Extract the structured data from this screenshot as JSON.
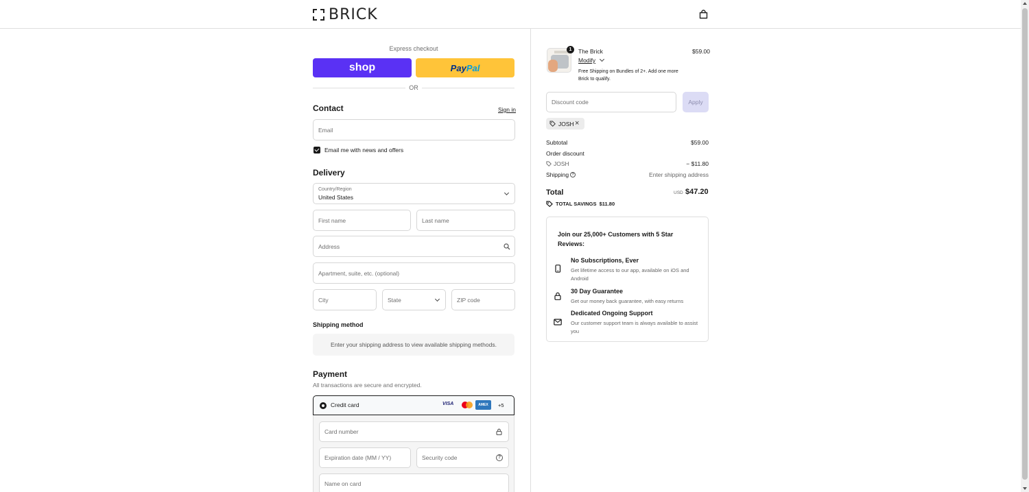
{
  "header": {
    "brand": "BRICK",
    "brand_icon": "brick-logo-icon",
    "cart_icon": "shopping-bag-icon"
  },
  "express": {
    "label": "Express checkout",
    "shop_label": "shop",
    "paypal_part1": "Pay",
    "paypal_part2": "Pal",
    "or": "OR",
    "shop_color": "#5a31f4",
    "paypal_color": "#ffc439"
  },
  "contact": {
    "title": "Contact",
    "signin": "Sign in",
    "email_placeholder": "Email",
    "newsletter_label": "Email me with news and offers",
    "newsletter_checked": true
  },
  "delivery": {
    "title": "Delivery",
    "country_label": "Country/Region",
    "country_value": "United States",
    "first_name_placeholder": "First name",
    "last_name_placeholder": "Last name",
    "address_placeholder": "Address",
    "apartment_placeholder": "Apartment, suite, etc. (optional)",
    "city_placeholder": "City",
    "state_placeholder": "State",
    "zip_placeholder": "ZIP code"
  },
  "shipping_method": {
    "title": "Shipping method",
    "message": "Enter your shipping address to view available shipping methods."
  },
  "payment": {
    "title": "Payment",
    "subtitle": "All transactions are secure and encrypted.",
    "method_label": "Credit card",
    "card_brands": [
      "VISA",
      "Mastercard",
      "AMEX"
    ],
    "more_cards": "+5",
    "card_number_placeholder": "Card number",
    "expiry_placeholder": "Expiration date (MM / YY)",
    "security_placeholder": "Security code",
    "name_placeholder": "Name on card"
  },
  "order": {
    "product_name": "The Brick",
    "product_price": "$59.00",
    "quantity": "1",
    "modify_label": "Modify",
    "promo_note": "Free Shipping on Bundles of 2+. Add one more Brick to qualify.",
    "discount_placeholder": "Discount code",
    "apply_label": "Apply",
    "applied_code": "JOSH",
    "subtotal_label": "Subtotal",
    "subtotal_value": "$59.00",
    "order_discount_label": "Order discount",
    "discount_code": "JOSH",
    "discount_value": "− $11.80",
    "shipping_label": "Shipping",
    "shipping_value": "Enter shipping address",
    "total_label": "Total",
    "total_currency": "USD",
    "total_value": "$47.20",
    "savings_label": "TOTAL SAVINGS",
    "savings_value": "$11.80"
  },
  "reviews": {
    "title": "Join our 25,000+ Customers with 5 Star Reviews:",
    "features": [
      {
        "icon": "phone-icon",
        "title": "No Subscriptions, Ever",
        "desc": "Get lifetime access to our app, available on iOS and Android"
      },
      {
        "icon": "lock-icon",
        "title": "30 Day Guarantee",
        "desc": "Get our money back guarantee, with easy returns"
      },
      {
        "icon": "mail-icon",
        "title": "Dedicated Ongoing Support",
        "desc": "Our customer support team is always available to assist you"
      }
    ]
  }
}
